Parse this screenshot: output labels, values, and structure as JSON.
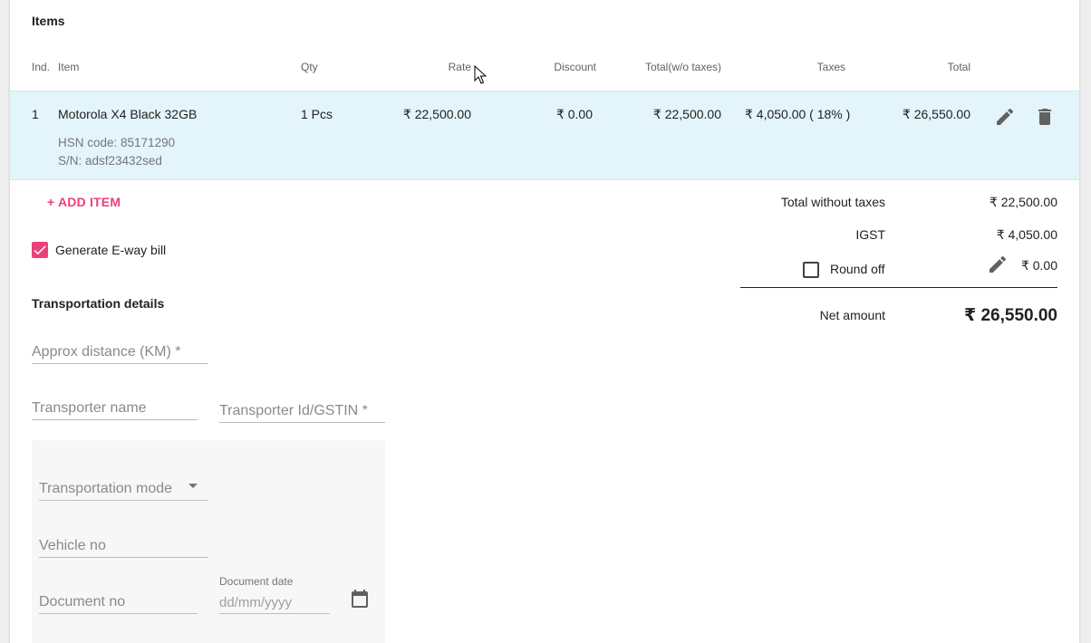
{
  "section": {
    "title": "Items"
  },
  "table": {
    "headers": [
      "Ind.",
      "Item",
      "Qty",
      "Rate",
      "Discount",
      "Total(w/o taxes)",
      "Taxes",
      "Total"
    ],
    "rows": [
      {
        "index": "1",
        "item": "Motorola X4 Black 32GB",
        "hsn": "HSN code: 85171290",
        "sn": "S/N:  adsf23432sed",
        "qty": "1 Pcs",
        "rate": "₹ 22,500.00",
        "discount": "₹ 0.00",
        "total_wo_taxes": "₹ 22,500.00",
        "taxes": "₹ 4,050.00 ( 18% )",
        "total": "₹ 26,550.00"
      }
    ],
    "edit_icon": "pencil-icon",
    "delete_icon": "trash-icon"
  },
  "add_item_label": "+ ADD ITEM",
  "eway": {
    "label": "Generate E-way bill",
    "checked": true
  },
  "summary": {
    "total_without_taxes_label": "Total without taxes",
    "total_without_taxes_value": "₹ 22,500.00",
    "igst_label": "IGST",
    "igst_value": "₹ 4,050.00",
    "round_off_label": "Round off",
    "round_off_checked": false,
    "round_off_value": "₹ 0.00",
    "net_amount_label": "Net amount",
    "net_amount_value": "₹ 26,550.00"
  },
  "transport": {
    "title": "Transportation details",
    "approx_distance_placeholder": "Approx distance (KM) *",
    "transporter_name_placeholder": "Transporter name",
    "transporter_id_placeholder": "Transporter Id/GSTIN *",
    "transportation_mode_placeholder": "Transportation mode",
    "vehicle_no_placeholder": "Vehicle no",
    "document_no_placeholder": "Document no",
    "document_date_label": "Document date",
    "document_date_value": "dd/mm/yyyy"
  },
  "colors": {
    "accent": "#ec407a",
    "row_highlight": "#e3f5fb"
  }
}
